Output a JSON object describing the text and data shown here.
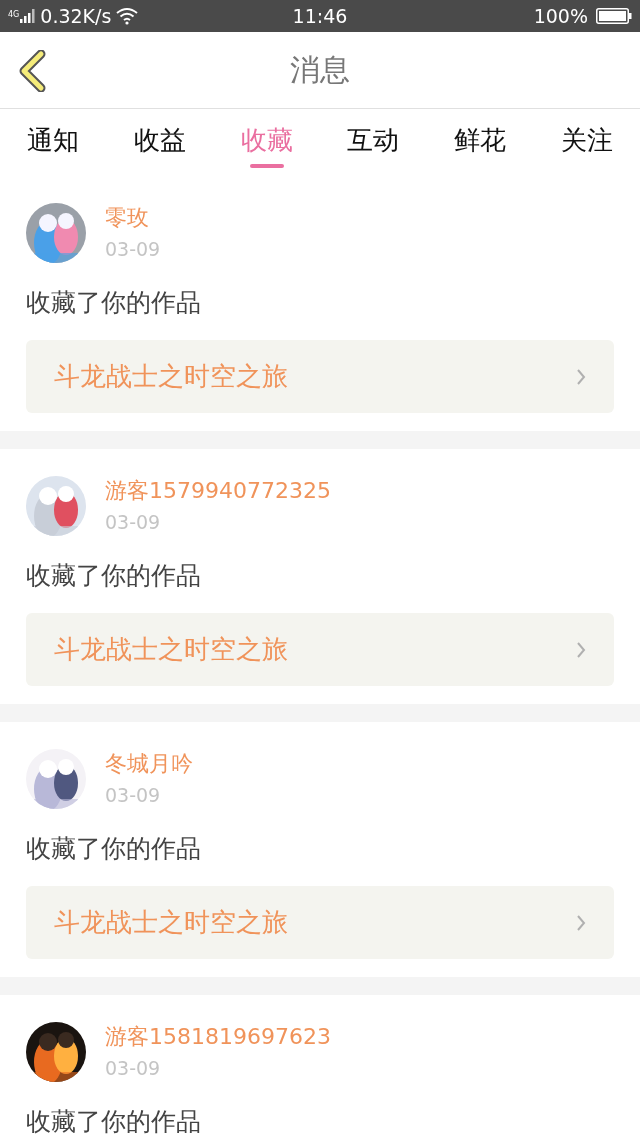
{
  "status_bar": {
    "network": "4G",
    "speed": "0.32K/s",
    "time": "11:46",
    "battery": "100%"
  },
  "header": {
    "title": "消息"
  },
  "tabs": [
    {
      "label": "通知",
      "selected": false
    },
    {
      "label": "收益",
      "selected": false
    },
    {
      "label": "收藏",
      "selected": true
    },
    {
      "label": "互动",
      "selected": false
    },
    {
      "label": "鲜花",
      "selected": false
    },
    {
      "label": "关注",
      "selected": false
    }
  ],
  "messages": [
    {
      "user": "零玫",
      "date": "03-09",
      "text": "收藏了你的作品",
      "work": "斗龙战士之时空之旅"
    },
    {
      "user": "游客1579940772325",
      "date": "03-09",
      "text": "收藏了你的作品",
      "work": "斗龙战士之时空之旅"
    },
    {
      "user": "冬城月吟",
      "date": "03-09",
      "text": "收藏了你的作品",
      "work": "斗龙战士之时空之旅"
    },
    {
      "user": "游客1581819697623",
      "date": "03-09",
      "text": "收藏了你的作品"
    }
  ]
}
